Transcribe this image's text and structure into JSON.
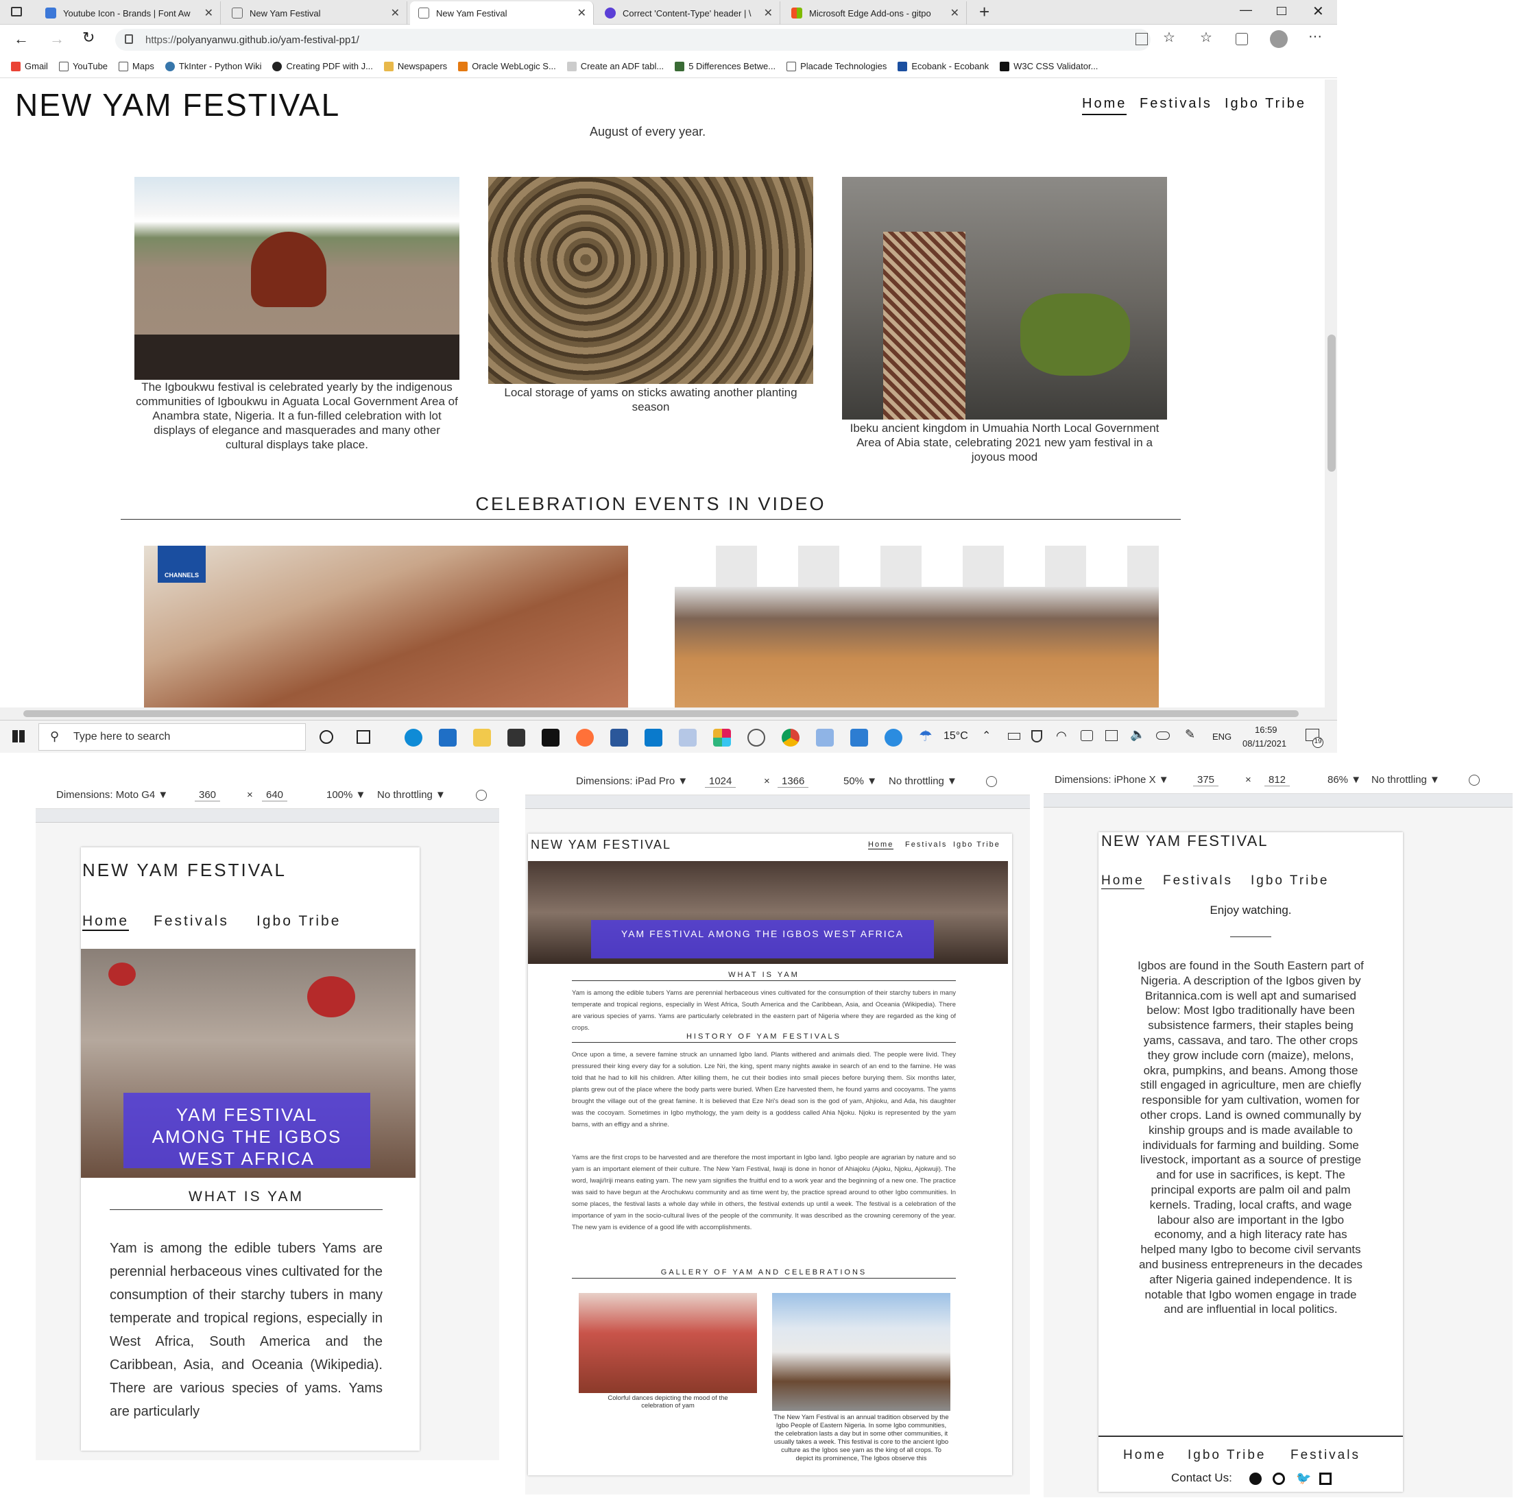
{
  "browser": {
    "tabs": [
      {
        "label": "Youtube Icon - Brands | Font Aw",
        "favicon_color": "#3c78d8"
      },
      {
        "label": "New Yam Festival",
        "favicon_color": "#888888"
      },
      {
        "label": "New Yam Festival",
        "favicon_color": "#888888"
      },
      {
        "label": "Correct 'Content-Type' header | \\",
        "favicon_color": "#5b3fd6"
      },
      {
        "label": "Microsoft Edge Add-ons - gitpo",
        "favicon_color": "#f25022"
      }
    ],
    "url_prefix": "https://",
    "url": "polyanyanwu.github.io/yam-festival-pp1/",
    "bookmarks": [
      "Gmail",
      "YouTube",
      "Maps",
      "TkInter - Python Wiki",
      "Creating PDF with J...",
      "Newspapers",
      "Oracle WebLogic S...",
      "Create an ADF tabl...",
      "5 Differences Betwe...",
      "Placade Technologies",
      "Ecobank - Ecobank",
      "W3C CSS Validator..."
    ]
  },
  "desktop": {
    "title": "NEW YAM FESTIVAL",
    "nav": [
      "Home",
      "Festivals",
      "Igbo Tribe"
    ],
    "intro_tail": "August of every year.",
    "gallery": [
      {
        "caption": "The Igboukwu festival is celebrated yearly by the indigenous communities of Igboukwu in Aguata Local Government Area of Anambra state, Nigeria. It a fun-filled celebration with lot displays of elegance and masquerades and many other cultural displays take place."
      },
      {
        "caption": "Local storage of yams on sticks awating another planting season"
      },
      {
        "caption": "Ibeku ancient kingdom in Umuahia North Local Government Area of Abia state, celebrating 2021 new yam festival in a joyous mood"
      }
    ],
    "video_heading": "CELEBRATION EVENTS IN VIDEO",
    "video_badge": "CHANNELS"
  },
  "taskbar": {
    "search_placeholder": "Type here to search",
    "weather": "15°C",
    "lang": "ENG",
    "time": "16:59",
    "date": "08/11/2021",
    "notifications": "19"
  },
  "devtools": {
    "moto": {
      "device": "Dimensions: Moto G4 ▼",
      "width": "360",
      "height": "640",
      "zoom": "100% ▼",
      "throttle": "No throttling ▼",
      "x": "×"
    },
    "ipad": {
      "device": "Dimensions: iPad Pro ▼",
      "width": "1024",
      "height": "1366",
      "zoom": "50% ▼",
      "throttle": "No throttling ▼",
      "x": "×"
    },
    "iphone": {
      "device": "Dimensions: iPhone X ▼",
      "width": "375",
      "height": "812",
      "zoom": "86% ▼",
      "throttle": "No throttling ▼",
      "x": "×"
    }
  },
  "mobile": {
    "title": "NEW YAM FESTIVAL",
    "nav": [
      "Home",
      "Festivals",
      "Igbo Tribe"
    ],
    "banner": "YAM FESTIVAL AMONG THE IGBOS WEST AFRICA",
    "section": "WHAT IS YAM",
    "text": "Yam is among the edible tubers Yams are perennial herbaceous vines cultivated for the consumption of their starchy tubers in many temperate and tropical regions, especially in West Africa, South America and the Caribbean, Asia, and Oceania (Wikipedia). There are various species of yams. Yams are particularly"
  },
  "tablet": {
    "title": "NEW YAM FESTIVAL",
    "nav": [
      "Home",
      "Festivals",
      "Igbo Tribe"
    ],
    "banner": "YAM FESTIVAL AMONG THE IGBOS WEST AFRICA",
    "section1": "WHAT IS YAM",
    "text1": "Yam is among the edible tubers Yams are perennial herbaceous vines cultivated for the consumption of their starchy tubers in many temperate and tropical regions, especially in West Africa, South America and the Caribbean, Asia, and Oceania (Wikipedia). There are various species of yams. Yams are particularly celebrated in the eastern part of Nigeria where they are regarded as the king of crops.",
    "section2": "HISTORY OF YAM FESTIVALS",
    "text2": "Once upon a time, a severe famine struck an unnamed Igbo land. Plants withered and animals died. The people were livid. They pressured their king every day for a solution. Lze Nri, the king, spent many nights awake in search of an end to the famine. He was told that he had to kill his children. After killing them, he cut their bodies into small pieces before burying them. Six months later, plants grew out of the place where the body parts were buried. When Eze harvested them, he found yams and cocoyams. The yams brought the village out of the great famine. It is believed that Eze Nri's dead son is the god of yam, Ahjioku, and Ada, his daughter was the cocoyam. Sometimes in Igbo mythology, the yam deity is a goddess called Ahia Njoku. Njoku is represented by the yam barns, with an effigy and a shrine.",
    "text3": "Yams are the first crops to be harvested and are therefore the most important in Igbo land. Igbo people are agrarian by nature and so yam is an important element of their culture. The New Yam Festival, Iwaji is done in honor of Ahiajoku (Ajoku, Njoku, Ajokwuji). The word, Iwaji/Iriji means eating yam. The new yam signifies the fruitful end to a work year and the beginning of a new one. The practice was said to have begun at the Arochukwu community and as time went by, the practice spread around to other Igbo communities. In some places, the festival lasts a whole day while in others, the festival extends up until a week. The festival is a celebration of the importance of yam in the socio-cultural lives of the people of the community. It was described as the crowning ceremony of the year. The new yam is evidence of a good life with accomplishments.",
    "section3": "GALLERY OF YAM AND CELEBRATIONS",
    "cap1": "Colorful dances depicting the mood of the celebration of yam",
    "cap2": "The New Yam Festival is an annual tradition observed by the Igbo People of Eastern Nigeria. In some Igbo communities, the celebration lasts a day but in some other communities, it usually takes a week. This festival is core to the ancient Igbo culture as the Igbos see yam as the king of all crops. To depict its prominence, The Igbos observe this"
  },
  "phone": {
    "title": "NEW YAM FESTIVAL",
    "nav": [
      "Home",
      "Festivals",
      "Igbo Tribe"
    ],
    "enjoy": "Enjoy watching.",
    "text": "Igbos are found in the South Eastern part of Nigeria. A description of the Igbos given by Britannica.com is well apt and sumarised below: Most Igbo traditionally have been subsistence farmers, their staples being yams, cassava, and taro. The other crops they grow include corn (maize), melons, okra, pumpkins, and beans. Among those still engaged in agriculture, men are chiefly responsible for yam cultivation, women for other crops. Land is owned communally by kinship groups and is made available to individuals for farming and building. Some livestock, important as a source of prestige and for use in sacrifices, is kept. The principal exports are palm oil and palm kernels. Trading, local crafts, and wage labour also are important in the Igbo economy, and a high literacy rate has helped many Igbo to become civil servants and business entrepreneurs in the decades after Nigeria gained independence. It is notable that Igbo women engage in trade and are influential in local politics.",
    "footer_nav": [
      "Home",
      "Igbo Tribe",
      "Festivals"
    ],
    "contact": "Contact Us:"
  }
}
